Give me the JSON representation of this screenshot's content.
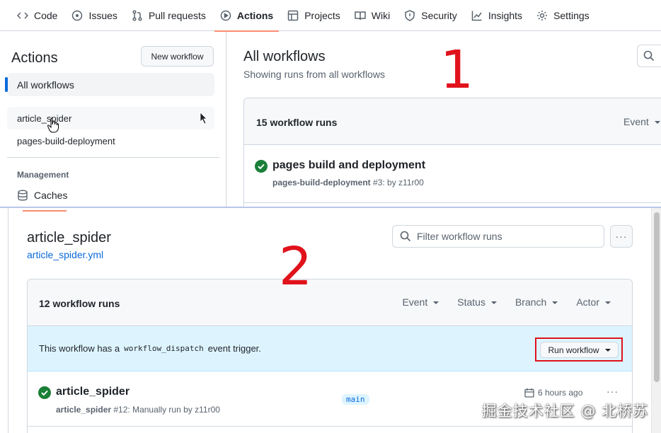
{
  "shot1": {
    "nav": {
      "tabs": [
        {
          "label": "Code",
          "icon": "code-icon"
        },
        {
          "label": "Issues",
          "icon": "issue-icon"
        },
        {
          "label": "Pull requests",
          "icon": "pull-request-icon"
        },
        {
          "label": "Actions",
          "icon": "play-icon",
          "active": true
        },
        {
          "label": "Projects",
          "icon": "table-icon"
        },
        {
          "label": "Wiki",
          "icon": "book-icon"
        },
        {
          "label": "Security",
          "icon": "shield-icon"
        },
        {
          "label": "Insights",
          "icon": "graph-icon"
        },
        {
          "label": "Settings",
          "icon": "gear-icon"
        }
      ]
    },
    "sidebar": {
      "title": "Actions",
      "new_workflow": "New workflow",
      "all_workflows": "All workflows",
      "workflows": [
        "article_spider",
        "pages-build-deployment"
      ],
      "management_heading": "Management",
      "caches": "Caches"
    },
    "main": {
      "title": "All workflows",
      "subtitle": "Showing runs from all workflows",
      "run_count": "15 workflow runs",
      "event_filter": "Event",
      "runs": [
        {
          "title": "pages build and deployment",
          "workflow": "pages-build-deployment",
          "meta": " #3: by z11r00",
          "status": "success"
        }
      ]
    },
    "annotation": "1"
  },
  "shot2": {
    "workflow_title": "article_spider",
    "workflow_file": "article_spider.yml",
    "filter_placeholder": "Filter workflow runs",
    "kebab": "···",
    "run_count": "12 workflow runs",
    "filters": [
      "Event",
      "Status",
      "Branch",
      "Actor"
    ],
    "dispatch": {
      "prefix": "This workflow has a",
      "code": "workflow_dispatch",
      "suffix": "event trigger.",
      "button": "Run workflow"
    },
    "runs": [
      {
        "title": "article_spider",
        "workflow": "article_spider",
        "meta": " #12: Manually run by z11r00",
        "branch": "main",
        "time": "6 hours ago",
        "status": "success"
      }
    ],
    "annotation": "2",
    "watermark": "掘金技术社区 @ 北桥苏"
  },
  "colors": {
    "accent": "#0969da",
    "success": "#1a7f37",
    "annotation_red": "#e0121b",
    "active_tab": "#fd8c73"
  }
}
